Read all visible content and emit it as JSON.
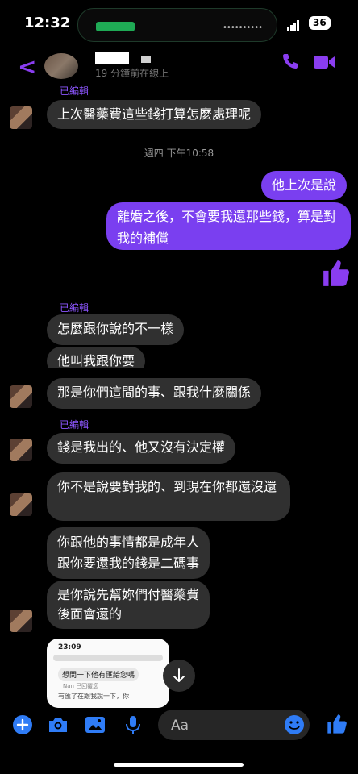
{
  "status_bar": {
    "time": "12:32",
    "battery": "36"
  },
  "header": {
    "status": "19 分鐘前在線上"
  },
  "messages": {
    "m1": "上次醫藥費這些錢打算怎麼處理呢",
    "timestamp": "週四 下午10:58",
    "o1": "他上次是說",
    "o2": "離婚之後，不會要我還那些錢，算是對我的補償",
    "m2": "怎麼跟你說的不一樣",
    "m3": "他叫我跟你要",
    "m4": "那是你們這間的事、跟我什麼關係",
    "m5": "錢是我出的、他又沒有決定權",
    "m6": "你不是說要對我的、到現在你都還沒還",
    "m7": "你跟他的事情都是成年人\n跟你要還我的錢是二碼事",
    "m8": "是你說先幫妳們付醫藥費\n後面會還的"
  },
  "edited_label": "已編輯",
  "thumbnail": {
    "time": "23:09",
    "bubble": "想問一下他有匯給您嗎",
    "meta": "Nan 已回覆您",
    "text": "有匯了在跟我說一下，你"
  },
  "composer": {
    "placeholder": "Aa"
  },
  "colors": {
    "accent": "#7a3ff0",
    "blue": "#2f7cf6",
    "bubble_in": "#303030"
  }
}
